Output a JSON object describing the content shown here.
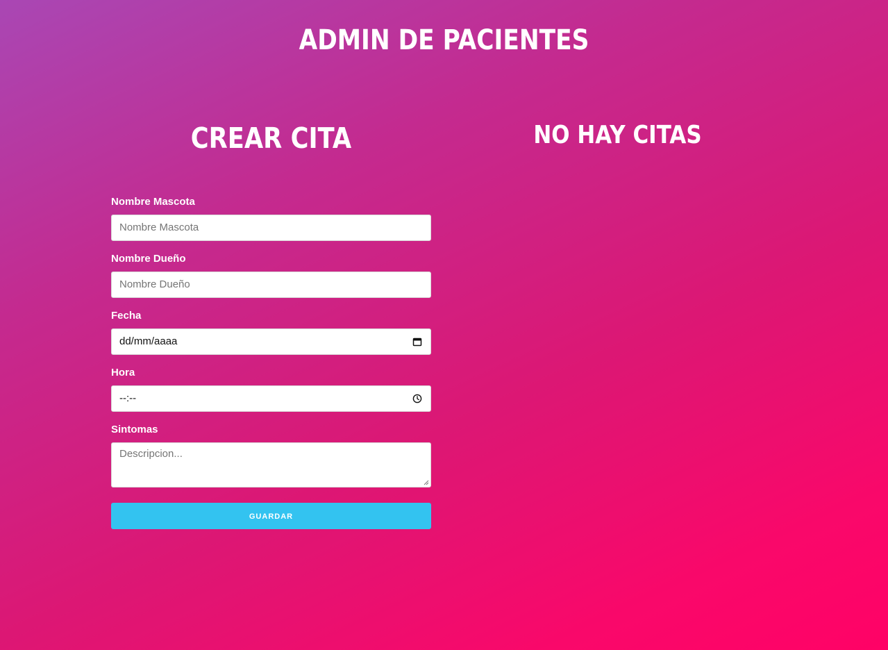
{
  "header": {
    "title": "ADMIN DE PACIENTES"
  },
  "form": {
    "title": "CREAR CITA",
    "fields": [
      {
        "label": "Nombre Mascota",
        "placeholder": "Nombre Mascota",
        "value": ""
      },
      {
        "label": "Nombre Dueño",
        "placeholder": "Nombre Dueño",
        "value": ""
      },
      {
        "label": "Fecha",
        "placeholder": "",
        "value": "dd/mm/aaaa",
        "icon": "calendar-icon"
      },
      {
        "label": "Hora",
        "placeholder": "",
        "value": "--:--",
        "icon": "clock-icon"
      },
      {
        "label": "Sintomas",
        "placeholder": "Descripcion...",
        "value": ""
      }
    ],
    "submit_label": "GUARDAR"
  },
  "appointments": {
    "title": "NO HAY CITAS"
  },
  "colors": {
    "gradient_start": "#a947b4",
    "gradient_end": "#ff0266",
    "button": "#33c3f0",
    "text": "#ffffff"
  }
}
